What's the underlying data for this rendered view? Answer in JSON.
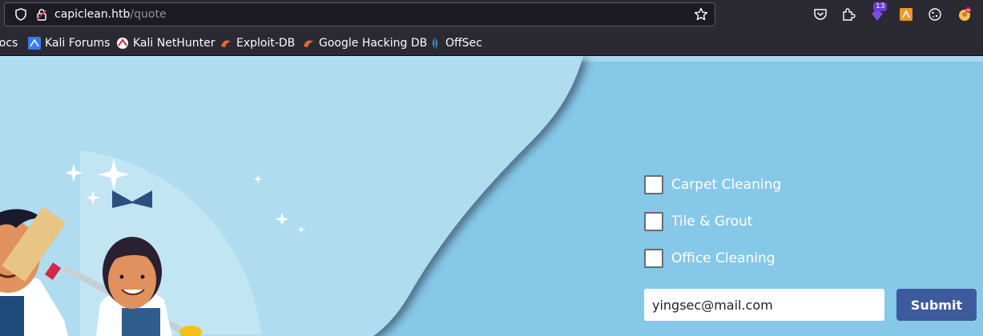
{
  "browser": {
    "url_host": "capiclean.htb",
    "url_path": "/quote",
    "extension_badge": "13"
  },
  "bookmarks": [
    {
      "label": "Docs"
    },
    {
      "label": "Kali Forums"
    },
    {
      "label": "Kali NetHunter"
    },
    {
      "label": "Exploit-DB"
    },
    {
      "label": "Google Hacking DB"
    },
    {
      "label": "OffSec"
    }
  ],
  "form": {
    "services": [
      {
        "label": "Carpet Cleaning",
        "checked": false
      },
      {
        "label": "Tile & Grout",
        "checked": false
      },
      {
        "label": "Office Cleaning",
        "checked": false
      }
    ],
    "email_value": "yingsec@mail.com",
    "submit_label": "Submit"
  },
  "colors": {
    "page_bg": "#86c8e8",
    "panel_light": "#b0dcef",
    "submit_bg": "#3d5a9c"
  }
}
